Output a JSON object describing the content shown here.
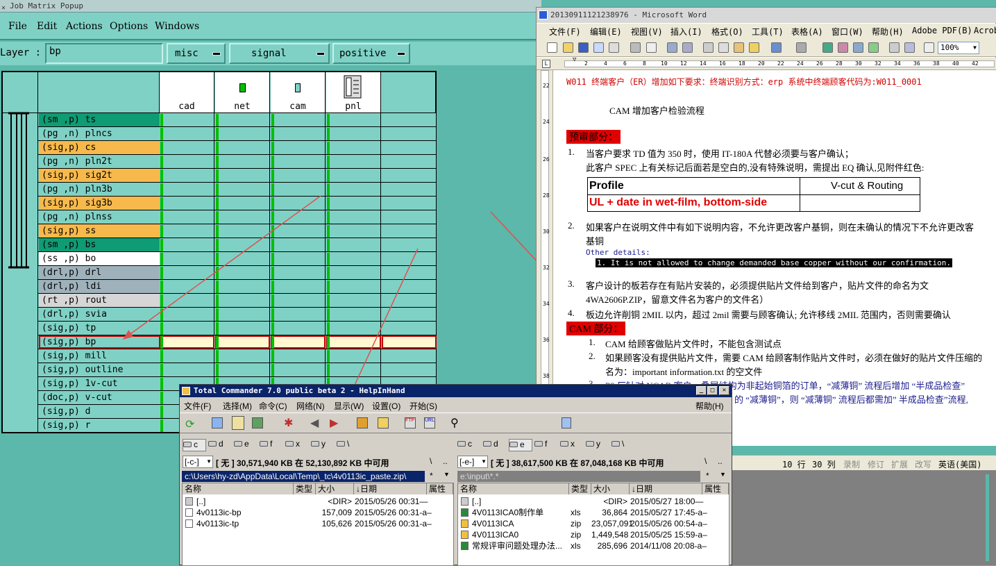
{
  "job_matrix": {
    "title": "Job Matrix Popup",
    "menu": [
      "File",
      "Edit",
      "Actions",
      "Options",
      "Windows"
    ],
    "layer_label": "Layer :",
    "layer_value": "bp",
    "dropdowns": [
      "misc",
      "signal",
      "positive"
    ],
    "columns": [
      "cad",
      "net",
      "cam",
      "pnl"
    ],
    "rows": [
      {
        "label": "(sm ,p) ts",
        "bg": "#0f9b73"
      },
      {
        "label": "(pg ,n) plncs",
        "bg": "#7fd1c5"
      },
      {
        "label": "(sig,p) cs",
        "bg": "#f7b94b"
      },
      {
        "label": "(pg ,n) pln2t",
        "bg": "#7fd1c5"
      },
      {
        "label": "(sig,p) sig2t",
        "bg": "#f7b94b"
      },
      {
        "label": "(pg ,n) pln3b",
        "bg": "#7fd1c5"
      },
      {
        "label": "(sig,p) sig3b",
        "bg": "#f7b94b"
      },
      {
        "label": "(pg ,n) plnss",
        "bg": "#7fd1c5"
      },
      {
        "label": "(sig,p) ss",
        "bg": "#f7b94b"
      },
      {
        "label": "(sm ,p) bs",
        "bg": "#0f9b73"
      },
      {
        "label": "(ss ,p) bo",
        "bg": "#ffffff"
      },
      {
        "label": "(drl,p) drl",
        "bg": "#9fb2bb"
      },
      {
        "label": "(drl,p) ldi",
        "bg": "#9fb2bb"
      },
      {
        "label": "(rt ,p) rout",
        "bg": "#d6d6d6"
      },
      {
        "label": "(drl,p) svia",
        "bg": "#7fd1c5"
      },
      {
        "label": "(sig,p) tp",
        "bg": "#7fd1c5"
      },
      {
        "label": "(sig,p) bp",
        "bg": "#7fd1c5"
      },
      {
        "label": "(sig,p) mill",
        "bg": "#7fd1c5"
      },
      {
        "label": "(sig,p) outline",
        "bg": "#7fd1c5"
      },
      {
        "label": "(sig,p) 1v-cut",
        "bg": "#7fd1c5"
      },
      {
        "label": "(doc,p) v-cut",
        "bg": "#7fd1c5"
      },
      {
        "label": "(sig,p) d",
        "bg": "#7fd1c5"
      },
      {
        "label": "(sig,p) r",
        "bg": "#7fd1c5"
      }
    ]
  },
  "word": {
    "title": "20130911121238976 - Microsoft Word",
    "menu": [
      "文件(F)",
      "编辑(E)",
      "视图(V)",
      "插入(I)",
      "格式(O)",
      "工具(T)",
      "表格(A)",
      "窗口(W)",
      "帮助(H)",
      "Adobe PDF(B)",
      "Acrobat"
    ],
    "zoom": "100%",
    "ruler_h": [
      "2",
      "4",
      "6",
      "8",
      "10",
      "12",
      "14",
      "16",
      "18",
      "20",
      "22",
      "24",
      "26",
      "28",
      "30",
      "32",
      "34",
      "36",
      "38",
      "40",
      "42"
    ],
    "ruler_v": [
      "22",
      "24",
      "26",
      "28",
      "30",
      "32",
      "34",
      "36",
      "38"
    ],
    "lines": {
      "l1": "W011 终端客户（ER）增加如下要求：终端识别方式：erp 系统中终端顾客代码为:W011_0001",
      "l2": "CAM 增加客户检验流程",
      "h_pre": "预审部分：",
      "i1n": "1.",
      "i1": "当客户要求 TD 值为 350 时，使用 IT-180A 代替必须要与客户确认；",
      "i1b": "此客户 SPEC 上有关标记后面若是空白的,没有特殊说明，需提出 EQ 确认,见附件红色:",
      "t_profile": "Profile",
      "t_vcut": "V-cut & Routing",
      "t_ul": "UL + date in wet-film, bottom-side",
      "i2n": "2.",
      "i2": "如果客户在说明文件中有如下说明内容，不允许更改客户基铜，则在未确认的情况下不允许更改客",
      "i2b": "基铜",
      "od": "Other details:",
      "od1": "1. It is not allowed to change demanded base copper without our confirmation.",
      "i3n": "3.",
      "i3": "客户设计的板若存在有贴片安装的，必须提供贴片文件给到客户，贴片文件的命名为文",
      "i3b": "4WA2606P.ZIP，留意文件名为客户的文件名）",
      "i4n": "4.",
      "i4": "板边允许削铜 2MIL 以内，超过 2mil 需要与顾客确认; 允许移线 2MIL 范围内，否则需要确认",
      "h_cam": "CAM 部分：",
      "c1n": "1.",
      "c1": "CAM 给顾客做贴片文件时，不能包含测试点",
      "c2n": "2.",
      "c2": "如果顾客没有提供贴片文件，需要 CAM 给顾客制作贴片文件时，必须在做好的贴片文件压缩的",
      "c2b": "名为：important information.txt 的空文件",
      "c3n": "3.",
      "c3": "P2 厂针对 NCAB 客户，叠层结构为非起始铜箔的订单，“减薄铜” 流程后增加 “半成品检查”",
      "c3b": "的 “减薄铜”，则 “减薄铜” 流程后都需加” 半成品检查”流程,"
    },
    "status": {
      "row": "10 行",
      "col": "30 列",
      "rec": "录制",
      "trk": "修订",
      "ext": "扩展",
      "ovr": "改写",
      "lang": "英语(美国)"
    }
  },
  "tc": {
    "title": "Total Commander 7.0 public beta 2 - HelpInHand",
    "menu": [
      "文件(F)",
      "选择(M)",
      "命令(C)",
      "网络(N)",
      "显示(W)",
      "设置(O)",
      "开始(S)"
    ],
    "help": "帮助(H)",
    "drives": [
      "c",
      "d",
      "e",
      "f",
      "x",
      "y",
      "\\"
    ],
    "left": {
      "drive": "[-c-]",
      "info": "[ 无 ]  30,571,940 KB 在 52,130,892 KB 中可用",
      "path": "c:\\Users\\hy-zd\\AppData\\Local\\Temp\\_tc\\4v0113ic_paste.zip\\",
      "files": [
        {
          "name": "[..]",
          "type": "",
          "size": "<DIR>",
          "date": "2015/05/26 00:31—"
        },
        {
          "name": "4v0113ic-bp",
          "type": "",
          "size": "157,009",
          "date": "2015/05/26 00:31-a–"
        },
        {
          "name": "4v0113ic-tp",
          "type": "",
          "size": "105,626",
          "date": "2015/05/26 00:31-a–"
        }
      ]
    },
    "right": {
      "drive": "[-e-]",
      "info": "[ 无 ]  38,617,500 KB 在 87,048,168 KB 中可用",
      "path": "e:\\input\\*.*",
      "files": [
        {
          "name": "[..]",
          "type": "",
          "size": "<DIR>",
          "date": "2015/05/27 18:00—"
        },
        {
          "name": "4V0113ICA0制作单",
          "type": "xls",
          "size": "36,864",
          "date": "2015/05/27 17:45-a–"
        },
        {
          "name": "4V0113ICA",
          "type": "zip",
          "size": "23,057,091",
          "date": "2015/05/26 00:54-a–"
        },
        {
          "name": "4V0113ICA0",
          "type": "zip",
          "size": "1,449,548",
          "date": "2015/05/25 15:59-a–"
        },
        {
          "name": "常规评审问题处理办法...",
          "type": "xls",
          "size": "285,696",
          "date": "2014/11/08 20:08-a–"
        }
      ]
    },
    "headers": [
      "名称",
      "类型",
      "大小",
      "↓日期",
      "属性"
    ],
    "slash": "\\",
    "dots": ".."
  }
}
